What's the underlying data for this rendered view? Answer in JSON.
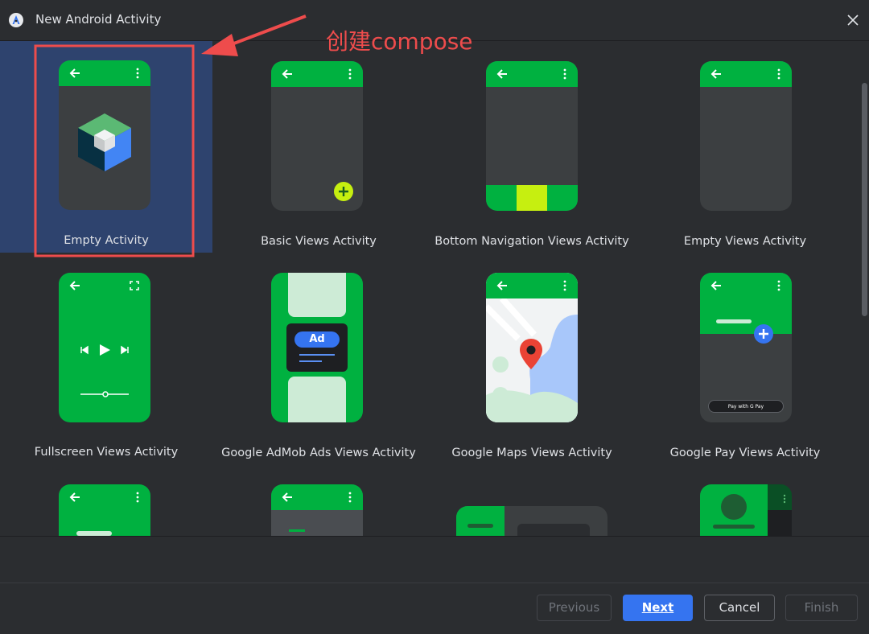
{
  "window": {
    "title": "New Android Activity"
  },
  "annotation": {
    "text": "创建compose",
    "color": "#ee4c4c"
  },
  "templates": [
    {
      "label": "Empty Activity",
      "selected": true
    },
    {
      "label": "Basic Views Activity"
    },
    {
      "label": "Bottom Navigation Views Activity"
    },
    {
      "label": "Empty Views Activity"
    },
    {
      "label": "Fullscreen Views Activity"
    },
    {
      "label": "Google AdMob Ads Views Activity",
      "badge": "Ad"
    },
    {
      "label": "Google Maps Views Activity"
    },
    {
      "label": "Google Pay Views Activity",
      "pay_text": "Pay with G Pay"
    }
  ],
  "buttons": {
    "previous": "Previous",
    "next": "Next",
    "cancel": "Cancel",
    "finish": "Finish"
  },
  "colors": {
    "accent": "#3574f0",
    "green": "#00b140",
    "selected": "#2e436e"
  }
}
